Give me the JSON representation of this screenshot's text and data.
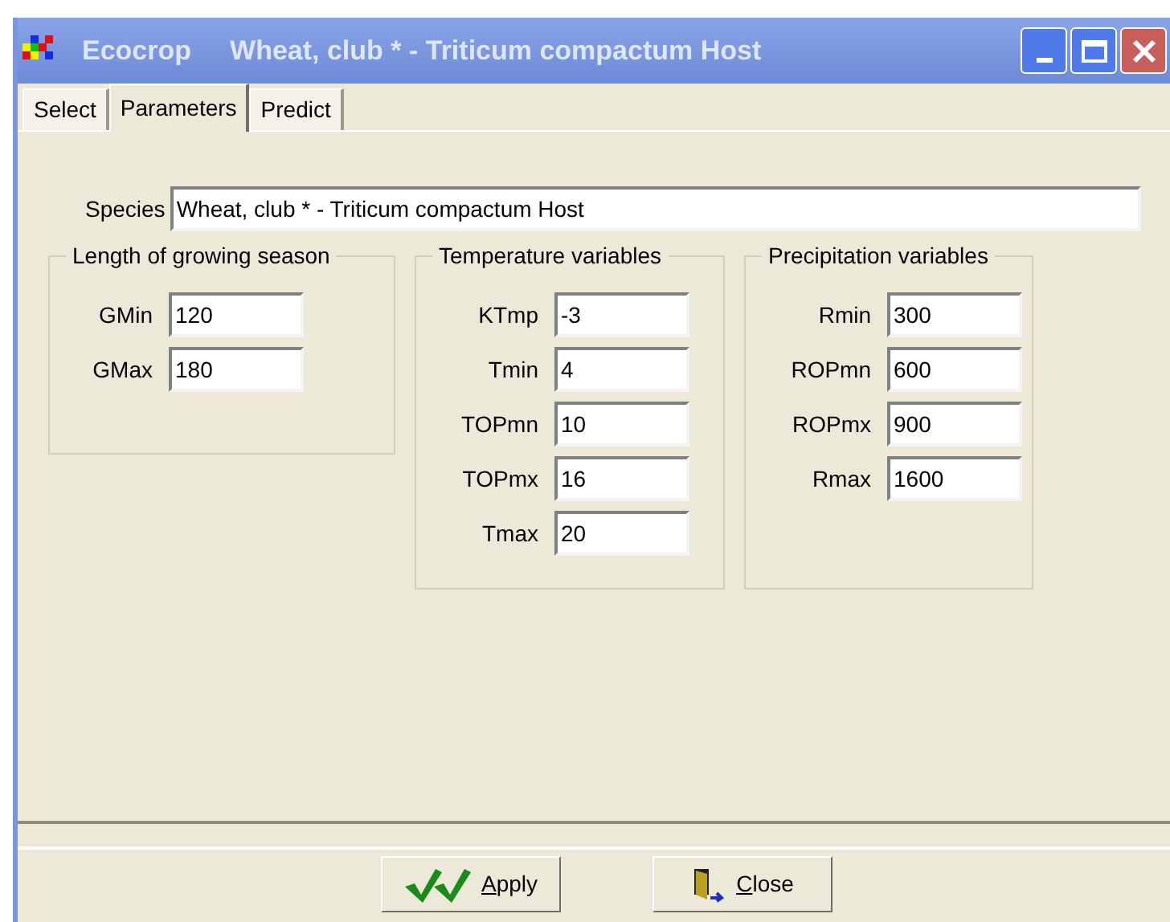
{
  "window": {
    "app": "Ecocrop",
    "title": "Wheat, club * - Triticum compactum Host"
  },
  "tabs": [
    {
      "label": "Select",
      "selected": false
    },
    {
      "label": "Parameters",
      "selected": true
    },
    {
      "label": "Predict",
      "selected": false
    }
  ],
  "species": {
    "label": "Species",
    "value": "Wheat, club * - Triticum compactum Host"
  },
  "groups": [
    {
      "title": "Length of growing season",
      "fields": [
        {
          "label": "GMin",
          "value": "120"
        },
        {
          "label": "GMax",
          "value": "180"
        }
      ]
    },
    {
      "title": "Temperature variables",
      "fields": [
        {
          "label": "KTmp",
          "value": "-3"
        },
        {
          "label": "Tmin",
          "value": "4"
        },
        {
          "label": "TOPmn",
          "value": "10"
        },
        {
          "label": "TOPmx",
          "value": "16"
        },
        {
          "label": "Tmax",
          "value": "20"
        }
      ]
    },
    {
      "title": "Precipitation variables",
      "fields": [
        {
          "label": "Rmin",
          "value": "300"
        },
        {
          "label": "ROPmn",
          "value": "600"
        },
        {
          "label": "ROPmx",
          "value": "900"
        },
        {
          "label": "Rmax",
          "value": "1600"
        }
      ]
    }
  ],
  "buttons": [
    {
      "kind": "apply",
      "label": "Apply"
    },
    {
      "kind": "close",
      "label": "Close"
    }
  ]
}
